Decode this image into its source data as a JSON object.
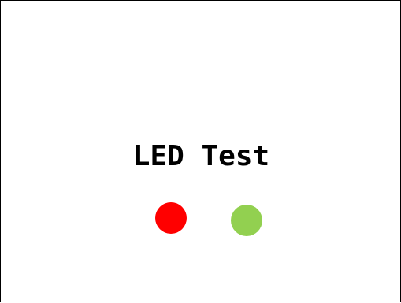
{
  "window": {
    "title": "LED Test"
  },
  "leds": [
    {
      "name": "red-led",
      "state": "on",
      "color": "#ff0000"
    },
    {
      "name": "green-led",
      "state": "on",
      "color": "#92d050"
    }
  ]
}
